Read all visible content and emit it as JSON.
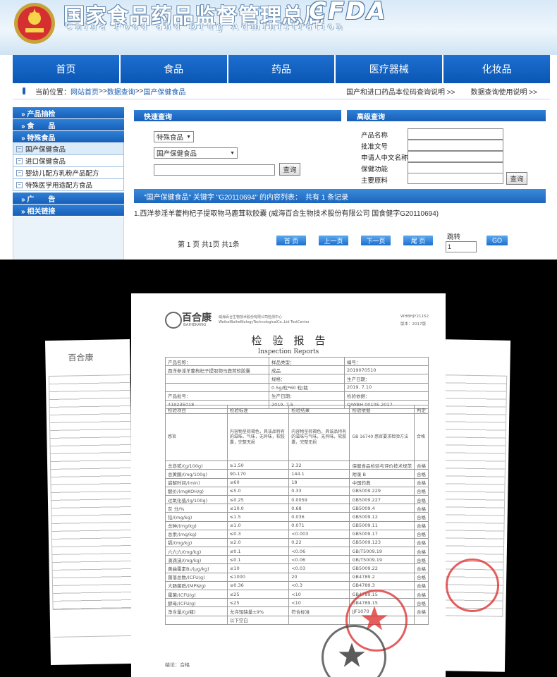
{
  "header": {
    "title_cn": "国家食品药品监督管理总局",
    "title_en": "China Food and Drug Administration",
    "logo_en": "CFDA"
  },
  "nav": [
    "首页",
    "食品",
    "药品",
    "医疗器械",
    "化妆品"
  ],
  "breadcrumb": {
    "prefix": "当前位置：",
    "items": [
      "网站首页",
      ">>",
      "数据查询",
      ">>",
      "国产保健食品"
    ],
    "right_links": [
      "国产和进口药品本位码查询说明 >>",
      "数据查询使用说明 >>"
    ]
  },
  "sidebar": {
    "categories": [
      "» 产品抽检",
      "» 食　　品",
      "» 特殊食品"
    ],
    "sub_items": [
      {
        "label": "国产保健食品",
        "active": true
      },
      {
        "label": "进口保健食品",
        "active": false
      },
      {
        "label": "婴幼儿配方乳粉产品配方",
        "active": false
      },
      {
        "label": "特殊医学用途配方食品",
        "active": false
      }
    ],
    "more_categories": [
      "» 广　　告",
      "» 相关链接"
    ]
  },
  "quick_search": {
    "title": "快速查询",
    "category_select": "特殊食品",
    "db_select": "国产保健食品",
    "button": "查询"
  },
  "advanced_search": {
    "title": "高级查询",
    "fields": [
      "产品名称",
      "批准文号",
      "申请人中文名称",
      "保健功能",
      "主要原料"
    ],
    "button": "查询"
  },
  "results": {
    "header": "\"国产保健食品\" 关键字 \"G20110694\" 的内容列表：　共有 1 条记录",
    "row": "1.西洋参淫羊藿枸杞子提取物马鹿茸软胶囊 (威海百合生物技术股份有限公司 国食健字G20110694)"
  },
  "pager": {
    "summary": "第 1 页 共1页 共1条",
    "buttons": [
      "首 页",
      "上一页",
      "下一页",
      "尾 页"
    ],
    "goto_label": "跳转",
    "goto_value": "1",
    "go_button": "GO"
  },
  "report": {
    "brand_cn": "百合康",
    "brand_en": "BAIHEKANG",
    "company_line1": "威海百合生物技术股份有限公司检测中心",
    "company_line2": "WeihaiBaiheBiologyTechnologicalCo.,Ltd TestCenter",
    "doc_no": "WHBHJY21152",
    "version": "版本：2017版",
    "title_cn": "检　验　报　告",
    "title_en": "Inspection Reports",
    "rows": [
      [
        "产品名称：",
        "样品类型：",
        "编号："
      ],
      [
        "西洋参淫羊藿枸杞子提取物马鹿茸软胶囊",
        "成品",
        "2019070510"
      ],
      [
        "",
        "规格：",
        "生产日期："
      ],
      [
        "",
        "0.5g/粒*60 粒/瓶",
        "2019. 7.10"
      ],
      [
        "产品批号：",
        "生产日期：",
        "检验依据："
      ],
      [
        "419235018",
        "2019. 7.5",
        "Q/WBH 0010S-2017"
      ]
    ],
    "table_header": [
      "检验项目",
      "检验标准",
      "检验结果",
      "检验依据",
      "判定"
    ],
    "table": [
      [
        "感官",
        "内容物呈棕褐色，具该品特有的滋味、气味，无异味，软胶囊，完整无损",
        "内容物呈棕褐色，具该品特有的滋味与气味，无异味，软胶囊，完整无损",
        "GB 16740 感官要求检验方法",
        "合格"
      ],
      [
        "总皂甙/(g/100g)",
        "≥1.50",
        "2.32",
        "保健食品检验与评价技术规范",
        "合格"
      ],
      [
        "总黄酮/(mg/100g)",
        "90-170",
        "144.1",
        "附录 B",
        "合格"
      ],
      [
        "崩解时间/(min)",
        "≤60",
        "18",
        "中国药典",
        "合格"
      ],
      [
        "酸价/(mgKOH/g)",
        "≤5.0",
        "0.33",
        "GB5009.229",
        "合格"
      ],
      [
        "过氧化值/(g/100g)",
        "≤0.25",
        "0.0059",
        "GB5009.227",
        "合格"
      ],
      [
        "灰 分/%",
        "≤10.0",
        "0.68",
        "GB5009.4",
        "合格"
      ],
      [
        "铅/(mg/kg)",
        "≤1.5",
        "0.036",
        "GB5009.12",
        "合格"
      ],
      [
        "总砷/(mg/kg)",
        "≤1.0",
        "0.071",
        "GB5009.11",
        "合格"
      ],
      [
        "总汞/(mg/kg)",
        "≤0.3",
        "<0.003",
        "GB5009.17",
        "合格"
      ],
      [
        "镉/(mg/kg)",
        "≤2.0",
        "0.22",
        "GB5009.123",
        "合格"
      ],
      [
        "六六六/(mg/kg)",
        "≤0.1",
        "<0.06",
        "GB/T5009.19",
        "合格"
      ],
      [
        "滴滴涕/(mg/kg)",
        "≤0.1",
        "<0.06",
        "GB/T5009.19",
        "合格"
      ],
      [
        "黄曲霉素B₁/(μg/kg)",
        "≤10",
        "<0.03",
        "GB5009.22",
        "合格"
      ],
      [
        "菌落总数/(CFU/g)",
        "≤1000",
        "20",
        "GB4789.2",
        "合格"
      ],
      [
        "大肠菌群/(MPN/g)",
        "≤0.36",
        "<0.3",
        "GB4789.3",
        "合格"
      ],
      [
        "霉菌/(CFU/g)",
        "≤25",
        "<10",
        "GB4789.15",
        "合格"
      ],
      [
        "酵母/(CFU/g)",
        "≤25",
        "<10",
        "GB4789.15",
        "合格"
      ],
      [
        "净含量/(g/瓶)",
        "允许短缺量±9%",
        "符合标准",
        "JJF1070",
        "合格"
      ],
      [
        "",
        "以下空白",
        "",
        "",
        ""
      ]
    ],
    "conclusion": "结论：合格"
  },
  "colors": {
    "nav_blue": "#0a56b4",
    "panel_blue": "#1e6fd0",
    "stamp_red": "#dc2828"
  }
}
